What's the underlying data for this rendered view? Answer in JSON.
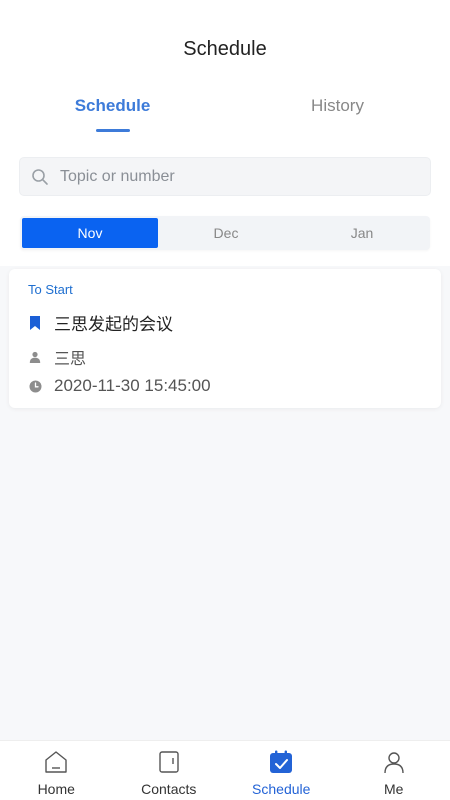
{
  "header": {
    "title": "Schedule"
  },
  "tabs": [
    {
      "label": "Schedule",
      "active": true
    },
    {
      "label": "History",
      "active": false
    }
  ],
  "search": {
    "placeholder": "Topic or number",
    "value": ""
  },
  "months": [
    {
      "label": "Nov",
      "active": true
    },
    {
      "label": "Dec",
      "active": false
    },
    {
      "label": "Jan",
      "active": false
    }
  ],
  "meeting": {
    "status": "To Start",
    "title": "三思发起的会议",
    "host": "三思",
    "time": "2020-11-30 15:45:00",
    "icons": [
      "bookmark-icon",
      "person-icon",
      "clock-icon"
    ]
  },
  "bottom_nav": [
    {
      "label": "Home",
      "icon": "home-icon",
      "active": false
    },
    {
      "label": "Contacts",
      "icon": "contacts-icon",
      "active": false
    },
    {
      "label": "Schedule",
      "icon": "calendar-icon",
      "active": true
    },
    {
      "label": "Me",
      "icon": "person-icon",
      "active": false
    }
  ],
  "colors": {
    "accent": "#3d7bd9",
    "active_month": "#0a63f1",
    "status_text": "#1f6fd0",
    "nav_active": "#2363d6"
  }
}
